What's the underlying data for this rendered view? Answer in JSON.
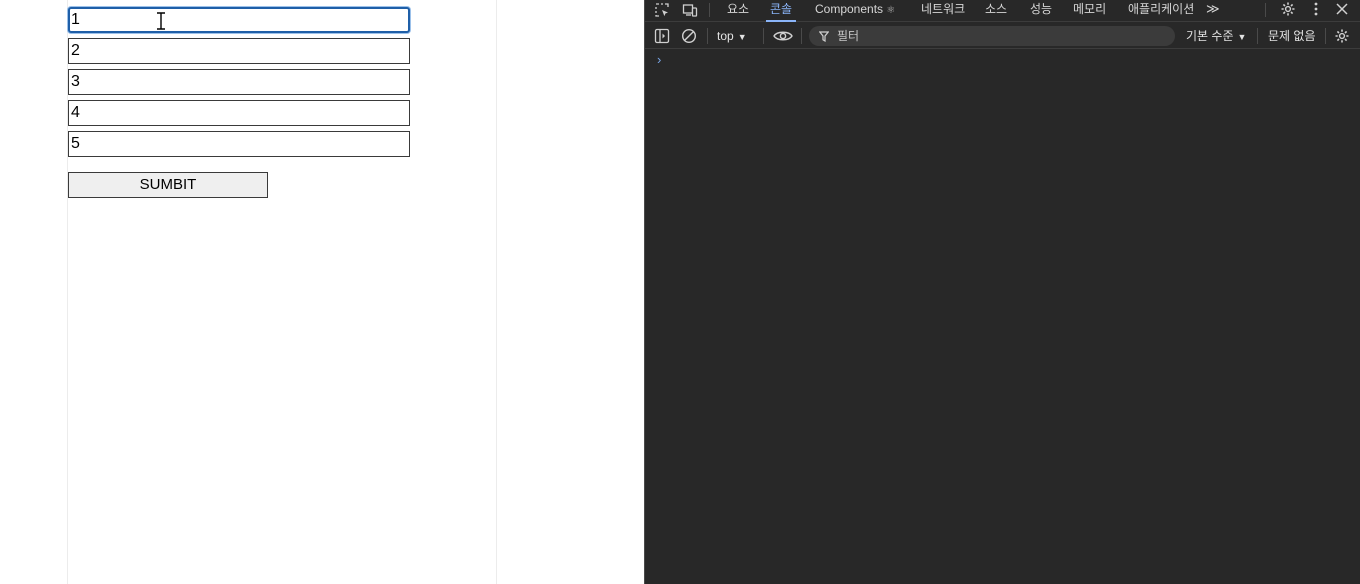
{
  "page": {
    "inputs": [
      {
        "value": "1"
      },
      {
        "value": "2"
      },
      {
        "value": "3"
      },
      {
        "value": "4"
      },
      {
        "value": "5"
      }
    ],
    "submit_label": "SUMBIT"
  },
  "devtools": {
    "tabs": [
      {
        "label": "요소"
      },
      {
        "label": "콘솔"
      },
      {
        "label": "Components"
      },
      {
        "label": "네트워크"
      },
      {
        "label": "소스"
      },
      {
        "label": "성능"
      },
      {
        "label": "메모리"
      },
      {
        "label": "애플리케이션"
      }
    ],
    "active_tab": "콘솔",
    "components_badge": "⚛",
    "more_tabs_glyph": "≫",
    "toolbar": {
      "context": "top",
      "filter_placeholder": "필터",
      "level": "기본 수준",
      "issues": "문제 없음"
    },
    "prompt_glyph": "›",
    "icons": [
      "inspect-icon",
      "device-toggle-icon",
      "settings-gear-icon",
      "kebab-menu-icon",
      "close-icon",
      "sidebar-toggle-icon",
      "clear-console-icon",
      "eye-icon",
      "filter-funnel-icon",
      "console-settings-gear-icon"
    ],
    "colors": {
      "background": "#282828",
      "accent": "#8ab4f8",
      "text": "#e3e3e3"
    }
  }
}
